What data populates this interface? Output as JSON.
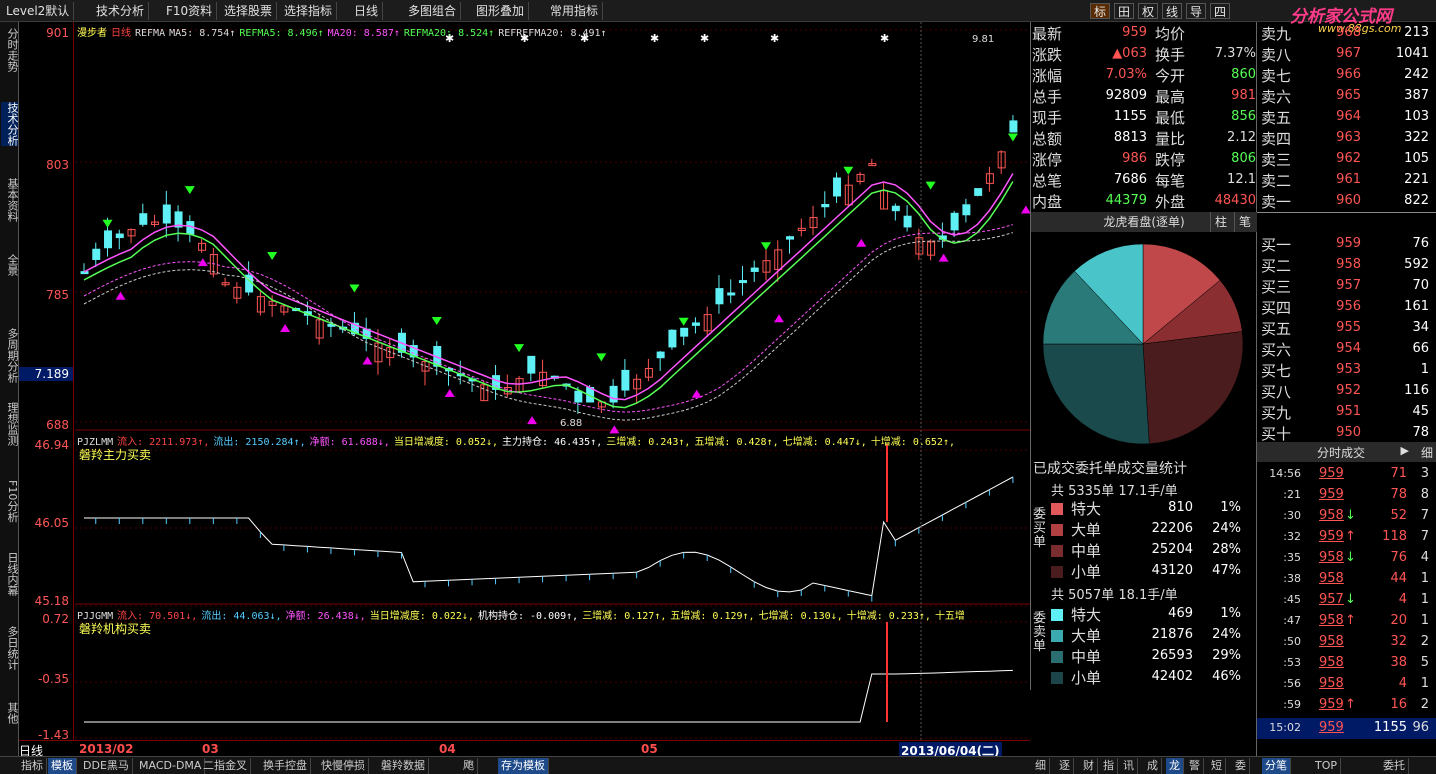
{
  "toolbar": {
    "items": [
      "Level2默认",
      "技术分析",
      "F10资料",
      "选择股票",
      "选择指标",
      "日线",
      "多图组合",
      "图形叠加",
      "常用指标"
    ],
    "right_icons": [
      "标",
      "田",
      "权",
      "线",
      "导",
      "四"
    ]
  },
  "logo": {
    "title": "分析家公式网",
    "url": "www.88gs.com"
  },
  "left_tabs": [
    "分时走势",
    "技术分析",
    "基本资料",
    "全景",
    "多周期分析",
    "理想监测",
    "F10分析",
    "日线内幕",
    "多日统计",
    "其他"
  ],
  "chart": {
    "stock_name": "漫步者",
    "period": "日线",
    "indicator_line": [
      {
        "t": "REFMA",
        "c": "#ddd"
      },
      {
        "t": "MA5: 8.754↑",
        "c": "#ddd"
      },
      {
        "t": "REFMA5: 8.496↑",
        "c": "#5f5"
      },
      {
        "t": "MA20: 8.587↑",
        "c": "#f5f"
      },
      {
        "t": "REFMA20: 8.524↑",
        "c": "#5f5"
      },
      {
        "t": "REFREFMA20: 8.491↑",
        "c": "#ddd"
      }
    ],
    "ylabels_main": [
      "901",
      "803",
      "785",
      "688"
    ],
    "current_price_label": "7.189",
    "high_label": "9.81",
    "low_label": "6.88",
    "panel2_title": [
      {
        "t": "PJZLMM",
        "c": "#ddd"
      },
      {
        "t": "流入: 2211.973↑,",
        "c": "#f44"
      },
      {
        "t": "流出: 2150.284↑,",
        "c": "#5cf"
      },
      {
        "t": "净额: 61.688↓,",
        "c": "#f5f"
      },
      {
        "t": "当日增减度: 0.052↓,",
        "c": "#ff5"
      },
      {
        "t": "主力持仓: 46.435↑,",
        "c": "#fff"
      },
      {
        "t": "三增减: 0.243↑,",
        "c": "#ff5"
      },
      {
        "t": "五增减: 0.428↑,",
        "c": "#ff5"
      },
      {
        "t": "七增减: 0.447↓,",
        "c": "#ff5"
      },
      {
        "t": "十增减: 0.652↑,",
        "c": "#ff5"
      }
    ],
    "panel2_label": "磐羚主力买卖",
    "ylabels_p2": [
      "46.94",
      "46.05",
      "45.18"
    ],
    "panel3_title": [
      {
        "t": "PJJGMM",
        "c": "#ddd"
      },
      {
        "t": "流入: 70.501↓,",
        "c": "#f44"
      },
      {
        "t": "流出: 44.063↓,",
        "c": "#5cf"
      },
      {
        "t": "净额: 26.438↓,",
        "c": "#f5f"
      },
      {
        "t": "当日增减度: 0.022↓,",
        "c": "#ff5"
      },
      {
        "t": "机构持仓: -0.009↑,",
        "c": "#fff"
      },
      {
        "t": "三增减: 0.127↑,",
        "c": "#ff5"
      },
      {
        "t": "五增减: 0.129↑,",
        "c": "#ff5"
      },
      {
        "t": "七增减: 0.130↓,",
        "c": "#ff5"
      },
      {
        "t": "十增减: 0.233↑,",
        "c": "#ff5"
      },
      {
        "t": "十五增",
        "c": "#ff5"
      }
    ],
    "panel3_label": "磐羚机构买卖",
    "ylabels_p3": [
      "0.72",
      "-0.35",
      "-1.43"
    ],
    "x_labels": [
      "2013/02",
      "03",
      "04",
      "05"
    ],
    "cursor_date": "2013/06/04(二)",
    "period_switch": "日线"
  },
  "bottom_tabs": [
    "指标",
    "模板",
    "DDE黑马",
    "MACD-DMA",
    "二指金叉",
    "换手控盘",
    "快慢停损",
    "磐羚数据",
    "飑",
    "存为模板"
  ],
  "bottom_right_tabs": [
    "细",
    "逐",
    "财",
    "指",
    "讯",
    "成",
    "龙",
    "警",
    "短",
    "委",
    "分笔",
    "TOP",
    "委托"
  ],
  "quote": {
    "rows": [
      {
        "k": "最新",
        "v": "959",
        "vc": "#ff5555",
        "k2": "均价",
        "v2": "",
        "v2c": "#ff5555"
      },
      {
        "k": "涨跌",
        "v": "▲063",
        "vc": "#ff5555",
        "k2": "换手",
        "v2": "7.37%",
        "v2c": "#ddd"
      },
      {
        "k": "涨幅",
        "v": "7.03%",
        "vc": "#ff5555",
        "k2": "今开",
        "v2": "860",
        "v2c": "#55ff55"
      },
      {
        "k": "总手",
        "v": "92809",
        "vc": "#ffffff",
        "k2": "最高",
        "v2": "981",
        "v2c": "#ff5555"
      },
      {
        "k": "现手",
        "v": "1155",
        "vc": "#ffffff",
        "k2": "最低",
        "v2": "856",
        "v2c": "#55ff55"
      },
      {
        "k": "总额",
        "v": "8813",
        "vc": "#ffffff",
        "k2": "量比",
        "v2": "2.12",
        "v2c": "#ddd"
      },
      {
        "k": "涨停",
        "v": "986",
        "vc": "#ff5555",
        "k2": "跌停",
        "v2": "806",
        "v2c": "#55ff55"
      },
      {
        "k": "总笔",
        "v": "7686",
        "vc": "#ffffff",
        "k2": "每笔",
        "v2": "12.1",
        "v2c": "#ddd"
      },
      {
        "k": "内盘",
        "v": "44379",
        "vc": "#55ff55",
        "k2": "外盘",
        "v2": "48430",
        "v2c": "#ff5555"
      }
    ]
  },
  "orderbook": {
    "sell": [
      {
        "k": "卖九",
        "p": "968",
        "q": "213"
      },
      {
        "k": "卖八",
        "p": "967",
        "q": "1041"
      },
      {
        "k": "卖七",
        "p": "966",
        "q": "242"
      },
      {
        "k": "卖六",
        "p": "965",
        "q": "387"
      },
      {
        "k": "卖五",
        "p": "964",
        "q": "103"
      },
      {
        "k": "卖四",
        "p": "963",
        "q": "322"
      },
      {
        "k": "卖三",
        "p": "962",
        "q": "105"
      },
      {
        "k": "卖二",
        "p": "961",
        "q": "221"
      },
      {
        "k": "卖一",
        "p": "960",
        "q": "822"
      }
    ],
    "buy": [
      {
        "k": "买一",
        "p": "959",
        "q": "76"
      },
      {
        "k": "买二",
        "p": "958",
        "q": "592"
      },
      {
        "k": "买三",
        "p": "957",
        "q": "70"
      },
      {
        "k": "买四",
        "p": "956",
        "q": "161"
      },
      {
        "k": "买五",
        "p": "955",
        "q": "34"
      },
      {
        "k": "买六",
        "p": "954",
        "q": "66"
      },
      {
        "k": "买七",
        "p": "953",
        "q": "1"
      },
      {
        "k": "买八",
        "p": "952",
        "q": "116"
      },
      {
        "k": "买九",
        "p": "951",
        "q": "45"
      },
      {
        "k": "买十",
        "p": "950",
        "q": "78"
      }
    ]
  },
  "pie": {
    "title": "龙虎看盘(逐单)",
    "btn1": "柱",
    "btn2": "笔",
    "slices": [
      {
        "value": 14,
        "color": "#c0474a"
      },
      {
        "value": 9,
        "color": "#8a2e31"
      },
      {
        "value": 26,
        "color": "#4a1c1d"
      },
      {
        "value": 26,
        "color": "#1b4a4c"
      },
      {
        "value": 13,
        "color": "#2a7a7a"
      },
      {
        "value": 12,
        "color": "#49c4c8"
      }
    ]
  },
  "stats": {
    "title": "已成交委托单成交量统计",
    "buy_head": "共 5335单 17.1手/单",
    "buy_side": "委买单",
    "buy": [
      {
        "n": "特大",
        "v": "810",
        "pc": "1%",
        "c": "#e0585a"
      },
      {
        "n": "大单",
        "v": "22206",
        "pc": "24%",
        "c": "#b04042"
      },
      {
        "n": "中单",
        "v": "25204",
        "pc": "28%",
        "c": "#7a2c2e"
      },
      {
        "n": "小单",
        "v": "43120",
        "pc": "47%",
        "c": "#4a1c1d"
      }
    ],
    "sell_head": "共 5057单 18.1手/单",
    "sell_side": "委卖单",
    "sell": [
      {
        "n": "特大",
        "v": "469",
        "pc": "1%",
        "c": "#5ff0f5"
      },
      {
        "n": "大单",
        "v": "21876",
        "pc": "24%",
        "c": "#3aaab0"
      },
      {
        "n": "中单",
        "v": "26593",
        "pc": "29%",
        "c": "#2a6e72"
      },
      {
        "n": "小单",
        "v": "42402",
        "pc": "46%",
        "c": "#1b4548"
      }
    ]
  },
  "ticks": {
    "title": "分时成交",
    "btn": "细",
    "rows": [
      {
        "t": "14:56",
        "p": "959",
        "v": "71",
        "n": "3",
        "arrow": ""
      },
      {
        "t": ":21",
        "p": "959",
        "v": "78",
        "n": "8",
        "arrow": ""
      },
      {
        "t": ":30",
        "p": "958",
        "v": "52",
        "n": "7",
        "arrow": "↓"
      },
      {
        "t": ":32",
        "p": "959",
        "v": "118",
        "n": "7",
        "arrow": "↑"
      },
      {
        "t": ":35",
        "p": "958",
        "v": "76",
        "n": "4",
        "arrow": "↓"
      },
      {
        "t": ":38",
        "p": "958",
        "v": "44",
        "n": "1",
        "arrow": ""
      },
      {
        "t": ":45",
        "p": "957",
        "v": "4",
        "n": "1",
        "arrow": "↓"
      },
      {
        "t": ":47",
        "p": "958",
        "v": "20",
        "n": "1",
        "arrow": "↑"
      },
      {
        "t": ":50",
        "p": "958",
        "v": "32",
        "n": "2",
        "arrow": ""
      },
      {
        "t": ":53",
        "p": "958",
        "v": "38",
        "n": "5",
        "arrow": ""
      },
      {
        "t": ":56",
        "p": "958",
        "v": "4",
        "n": "1",
        "arrow": ""
      },
      {
        "t": ":59",
        "p": "959",
        "v": "16",
        "n": "2",
        "arrow": "↑"
      }
    ],
    "last": {
      "t": "15:02",
      "p": "959",
      "v": "1155",
      "n": "96"
    }
  }
}
